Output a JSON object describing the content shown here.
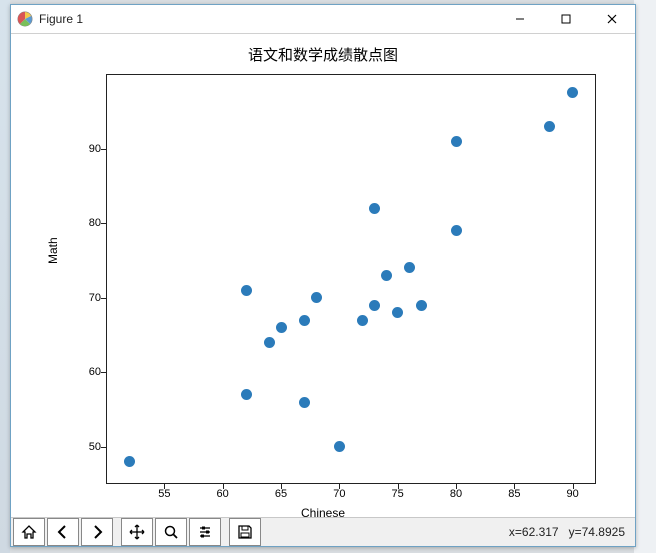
{
  "window": {
    "title": "Figure 1",
    "min_label": "—",
    "max_label": "☐",
    "close_label": "✕"
  },
  "toolbar": {
    "home": "home-icon",
    "back": "back-icon",
    "forward": "forward-icon",
    "pan": "pan-icon",
    "zoom": "zoom-icon",
    "configure": "configure-icon",
    "save": "save-icon"
  },
  "status": {
    "x_label": "x=62.317",
    "y_label": "y=74.8925"
  },
  "chart_data": {
    "type": "scatter",
    "title": "语文和数学成绩散点图",
    "xlabel": "Chinese",
    "ylabel": "Math",
    "xlim": [
      50,
      92
    ],
    "ylim": [
      45,
      100
    ],
    "xticks": [
      55,
      60,
      65,
      70,
      75,
      80,
      85,
      90
    ],
    "yticks": [
      50,
      60,
      70,
      80,
      90
    ],
    "points": [
      {
        "x": 52,
        "y": 48
      },
      {
        "x": 62,
        "y": 57
      },
      {
        "x": 62,
        "y": 71
      },
      {
        "x": 64,
        "y": 64
      },
      {
        "x": 65,
        "y": 66
      },
      {
        "x": 67,
        "y": 56
      },
      {
        "x": 67,
        "y": 67
      },
      {
        "x": 68,
        "y": 70
      },
      {
        "x": 70,
        "y": 50
      },
      {
        "x": 72,
        "y": 67
      },
      {
        "x": 73,
        "y": 69
      },
      {
        "x": 73,
        "y": 82
      },
      {
        "x": 74,
        "y": 73
      },
      {
        "x": 75,
        "y": 68
      },
      {
        "x": 76,
        "y": 74
      },
      {
        "x": 77,
        "y": 69
      },
      {
        "x": 80,
        "y": 79
      },
      {
        "x": 80,
        "y": 91
      },
      {
        "x": 88,
        "y": 93
      },
      {
        "x": 90,
        "y": 97.5
      }
    ]
  }
}
